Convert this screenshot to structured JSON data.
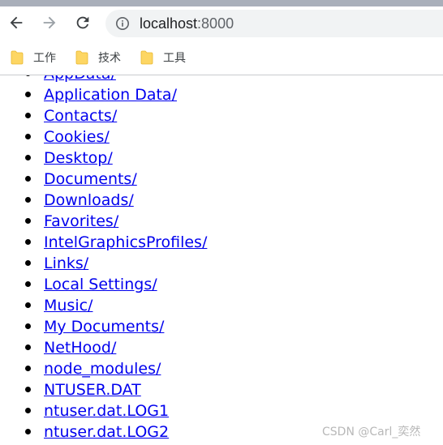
{
  "browser": {
    "address_bar": {
      "host": "localhost",
      "port": ":8000"
    },
    "bookmarks": [
      {
        "label": "工作",
        "icon": "folder-icon"
      },
      {
        "label": "技术",
        "icon": "folder-icon"
      },
      {
        "label": "工具",
        "icon": "folder-icon"
      }
    ],
    "icons": {
      "back": "arrow-left-icon",
      "forward": "arrow-right-icon",
      "reload": "reload-icon",
      "site_info": "info-icon"
    },
    "colors": {
      "top_strip": "#a9afba",
      "omnibox": "#f1f3f4",
      "folder": "#fdd663",
      "link": "#0000ee"
    }
  },
  "directory_listing": {
    "entries": [
      "AppData/",
      "Application Data/",
      "Contacts/",
      "Cookies/",
      "Desktop/",
      "Documents/",
      "Downloads/",
      "Favorites/",
      "IntelGraphicsProfiles/",
      "Links/",
      "Local Settings/",
      "Music/",
      "My Documents/",
      "NetHood/",
      "node_modules/",
      "NTUSER.DAT",
      "ntuser.dat.LOG1",
      "ntuser.dat.LOG2"
    ]
  },
  "watermark": {
    "text": "CSDN @Carl_奕然"
  }
}
